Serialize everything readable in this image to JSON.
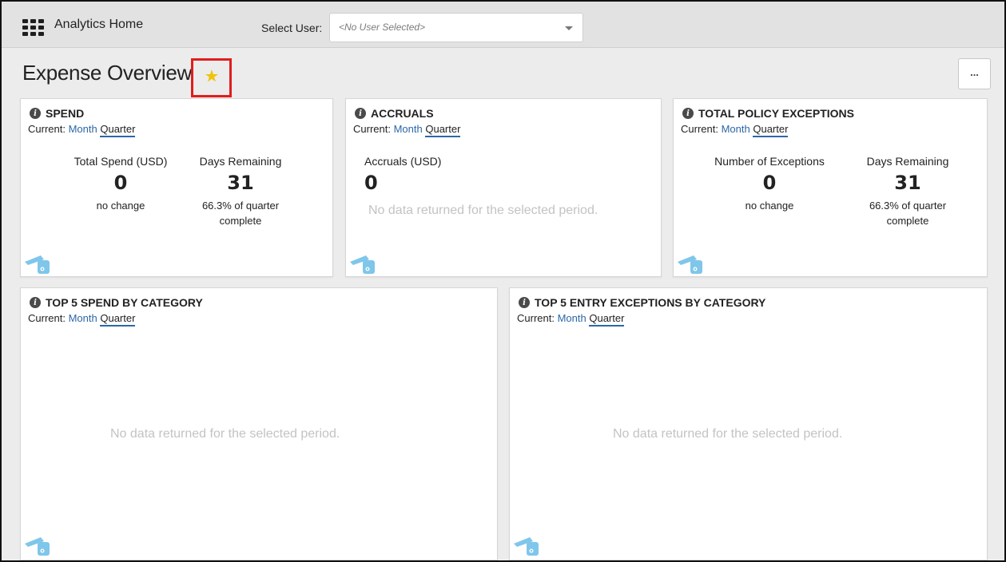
{
  "header": {
    "app_title": "Analytics Home",
    "user_label": "Select User:",
    "user_placeholder": "<No User Selected>"
  },
  "page": {
    "title": "Expense Overview",
    "more_label": "..."
  },
  "colors": {
    "accent": "#2b67a8",
    "star": "#f2c400",
    "highlight_box": "#e11d1d",
    "nodata_text": "#c3c3c3"
  },
  "cards": {
    "spend": {
      "title": "SPEND",
      "current_label": "Current:",
      "opt_month": "Month",
      "opt_quarter": "Quarter",
      "m1_label": "Total Spend (USD)",
      "m1_value": "0",
      "m1_sub": "no change",
      "m2_label": "Days Remaining",
      "m2_value": "31",
      "m2_sub1": "66.3% of quarter",
      "m2_sub2": "complete"
    },
    "accruals": {
      "title": "ACCRUALS",
      "current_label": "Current:",
      "opt_month": "Month",
      "opt_quarter": "Quarter",
      "m1_label": "Accruals (USD)",
      "m1_value": "0",
      "nodata": "No data returned for the selected period."
    },
    "policy": {
      "title": "TOTAL POLICY EXCEPTIONS",
      "current_label": "Current:",
      "opt_month": "Month",
      "opt_quarter": "Quarter",
      "m1_label": "Number of Exceptions",
      "m1_value": "0",
      "m1_sub": "no change",
      "m2_label": "Days Remaining",
      "m2_value": "31",
      "m2_sub1": "66.3% of quarter",
      "m2_sub2": "complete"
    },
    "top_spend": {
      "title": "TOP 5 SPEND BY CATEGORY",
      "current_label": "Current:",
      "opt_month": "Month",
      "opt_quarter": "Quarter",
      "nodata": "No data returned for the selected period."
    },
    "top_exceptions": {
      "title": "TOP 5 ENTRY EXCEPTIONS BY CATEGORY",
      "current_label": "Current:",
      "opt_month": "Month",
      "opt_quarter": "Quarter",
      "nodata": "No data returned for the selected period."
    }
  },
  "icons": {
    "apps": "apps-grid-icon",
    "favorite": "star-icon",
    "info": "info-icon",
    "card_footer": "wallet-icon",
    "dropdown": "chevron-down-icon"
  }
}
